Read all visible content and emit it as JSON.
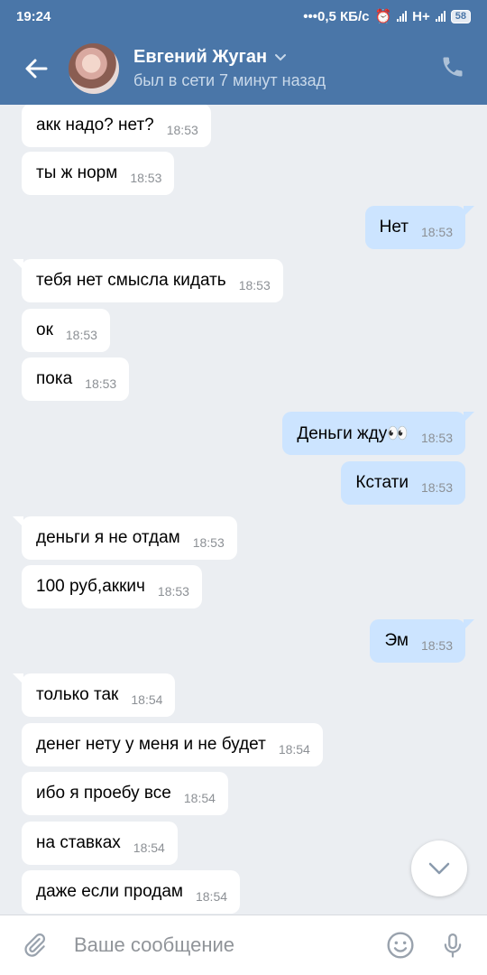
{
  "status_bar": {
    "time": "19:24",
    "network_speed": "0,5 КБ/с",
    "network_type": "H+",
    "battery": "58"
  },
  "header": {
    "contact_name": "Евгений Жуган",
    "last_seen": "был в сети 7 минут назад"
  },
  "messages": [
    {
      "dir": "in",
      "text": "акк надо? нет?",
      "time": "18:53"
    },
    {
      "dir": "in",
      "text": "ты ж норм",
      "time": "18:53"
    },
    {
      "dir": "out",
      "text": "Нет",
      "time": "18:53"
    },
    {
      "dir": "in",
      "text": "тебя нет смысла кидать",
      "time": "18:53"
    },
    {
      "dir": "in",
      "text": "ок",
      "time": "18:53"
    },
    {
      "dir": "in",
      "text": "пока",
      "time": "18:53"
    },
    {
      "dir": "out",
      "text": "Деньги жду👀",
      "time": "18:53"
    },
    {
      "dir": "out",
      "text": "Кстати",
      "time": "18:53"
    },
    {
      "dir": "in",
      "text": "деньги я не отдам",
      "time": "18:53"
    },
    {
      "dir": "in",
      "text": "100 руб,аккич",
      "time": "18:53"
    },
    {
      "dir": "out",
      "text": "Эм",
      "time": "18:53"
    },
    {
      "dir": "in",
      "text": "только так",
      "time": "18:54"
    },
    {
      "dir": "in",
      "text": "денег нету у меня и не будет",
      "time": "18:54"
    },
    {
      "dir": "in",
      "text": "ибо я проебу все",
      "time": "18:54"
    },
    {
      "dir": "in",
      "text": "на ставках",
      "time": "18:54"
    },
    {
      "dir": "in",
      "text": "даже если продам",
      "time": "18:54"
    }
  ],
  "composer": {
    "placeholder": "Ваше сообщение"
  },
  "colors": {
    "header_bg": "#4a76a8",
    "chat_bg": "#ebeef2",
    "incoming_bubble": "#ffffff",
    "outgoing_bubble": "#cce4ff"
  }
}
